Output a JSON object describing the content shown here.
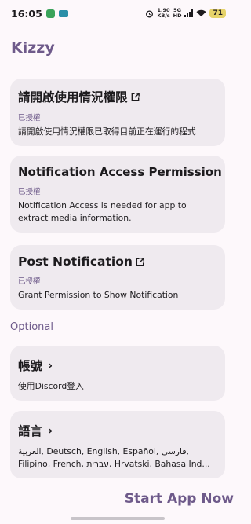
{
  "status_bar": {
    "time": "16:05",
    "net_speed_top": "1.90",
    "net_speed_unit": "KB/s",
    "net_type_top": "5G",
    "net_type_bottom": "HD",
    "battery": "71"
  },
  "app": {
    "title": "Kizzy"
  },
  "permissions": [
    {
      "title": "請開啟使用情況權限",
      "status": "已授權",
      "description": "請開啟使用情況權限已取得目前正在運行的程式"
    },
    {
      "title": "Notification Access Permission",
      "status": "已授權",
      "description": "Notification Access is needed for app to extract media information."
    },
    {
      "title": "Post Notification",
      "status": "已授權",
      "description": "Grant Permission to Show Notification"
    }
  ],
  "optional": {
    "label": "Optional",
    "account": {
      "title": "帳號",
      "description": "使用Discord登入"
    },
    "language": {
      "title": "語言",
      "description": "العربية, Deutsch, English, Español, فارسی, Filipino, French, עברית, Hrvatski, Bahasa Ind..."
    }
  },
  "start_button": "Start App Now",
  "icons": {
    "external": "external-link-icon",
    "chevron": "chevron-right-icon"
  },
  "colors": {
    "accent": "#6e5a8a",
    "card_bg": "#efeaef",
    "page_bg": "#fdf8fb"
  }
}
